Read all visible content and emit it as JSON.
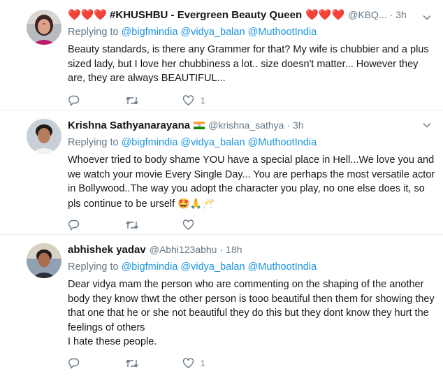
{
  "tweets": [
    {
      "name": "#KHUSHBU - Evergreen Beauty Queen",
      "handle": "@KBQ...",
      "separator": "·",
      "time": "3h",
      "replying_prefix": "Replying to",
      "mentions": [
        "@bigfmindia",
        "@vidya_balan",
        "@MuthootIndia"
      ],
      "text": [
        "Beauty standards, is there any Grammer for that? My wife is chubbier and a plus sized lady, but I love her chubbiness a lot.. size doesn't matter... However they are, they are always BEAUTIFUL..."
      ],
      "likes": "1"
    },
    {
      "name": "Krishna Sathyanarayana",
      "handle": "@krishna_sathya",
      "separator": "·",
      "time": "3h",
      "replying_prefix": "Replying to",
      "mentions": [
        "@bigfmindia",
        "@vidya_balan",
        "@MuthootIndia"
      ],
      "text": [
        "Whoever tried to body shame YOU have a special place in Hell...We love you and we watch your movie Every Single Day... You are perhaps the most versatile actor in Bollywood..The way you adopt the character you play, no one else does it, so pls continue to be urself"
      ],
      "emojis": "🤩🙏🥂",
      "likes": ""
    },
    {
      "name": "abhishek yadav",
      "handle": "@Abhi123abhu",
      "separator": "·",
      "time": "18h",
      "replying_prefix": "Replying to",
      "mentions": [
        "@bigfmindia",
        "@vidya_balan",
        "@MuthootIndia"
      ],
      "text": [
        "Dear vidya mam the person who are commenting on the shaping of the another body they know thwt the other person is tooo beautiful then them for showing they that one that he or she not beautiful they do this but they dont know they hurt the feelings of others",
        "I hate these people."
      ],
      "likes": "1"
    }
  ],
  "colors": {
    "link": "#1b95e0",
    "muted": "#657786",
    "heart": "#e0245e",
    "divider": "#e6ecf0"
  },
  "icons": [
    "heart-emoji",
    "india-flag-icon",
    "chevron-down-icon",
    "reply-icon",
    "retweet-icon",
    "like-icon"
  ]
}
